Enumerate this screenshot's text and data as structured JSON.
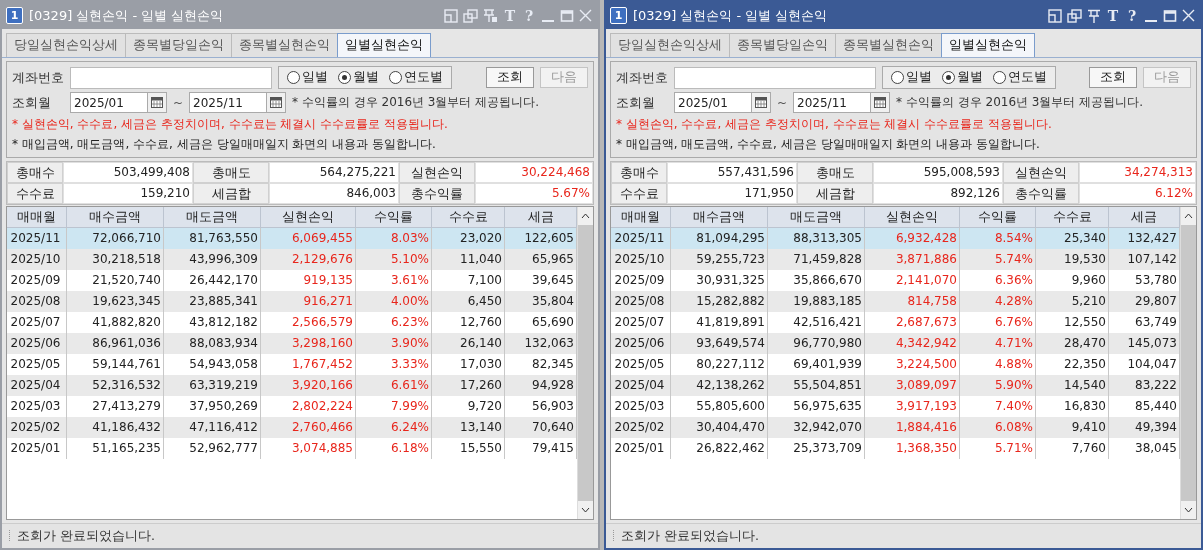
{
  "windows": [
    {
      "active": false,
      "badge": "1",
      "title": "[0329] 실현손익 - 일별 실현손익",
      "tools": [
        {
          "kind": "layout"
        },
        {
          "kind": "copy"
        },
        {
          "kind": "pin-lock"
        },
        {
          "kind": "text",
          "label": "T"
        },
        {
          "kind": "text",
          "label": "?"
        },
        {
          "kind": "minimize"
        },
        {
          "kind": "maximize"
        },
        {
          "kind": "close"
        }
      ],
      "tabs": [
        {
          "label": "당일실현손익상세",
          "selected": false
        },
        {
          "label": "종목별당일손익",
          "selected": false
        },
        {
          "label": "종목별실현손익",
          "selected": false
        },
        {
          "label": "일별실현손익",
          "selected": true
        }
      ],
      "account_label": "계좌번호",
      "radios": [
        {
          "label": "일별",
          "selected": false
        },
        {
          "label": "월별",
          "selected": true
        },
        {
          "label": "연도별",
          "selected": false
        }
      ],
      "buttons": [
        {
          "label": "조회",
          "disabled": false
        },
        {
          "label": "다음",
          "disabled": true
        }
      ],
      "period_label": "조회월",
      "from": "2025/01",
      "tilde": "~",
      "to": "2025/11",
      "period_note": "* 수익률의 경우 2016년 3월부터 제공됩니다.",
      "notes": [
        {
          "text": "* 실현손익, 수수료, 세금은 추정치이며, 수수료는 체결시 수수료률로 적용됩니다.",
          "emphasis": true
        },
        {
          "text": "* 매입금액, 매도금액, 수수료, 세금은 당일매매일지 화면의 내용과 동일합니다.",
          "emphasis": false
        }
      ],
      "summary": [
        {
          "label": "총매수",
          "value": "503,499,408",
          "emphasis": false
        },
        {
          "label": "총매도",
          "value": "564,275,221",
          "emphasis": false
        },
        {
          "label": "실현손익",
          "value": "30,224,468",
          "emphasis": true
        },
        {
          "label": "수수료",
          "value": "159,210",
          "emphasis": false
        },
        {
          "label": "세금합",
          "value": "846,003",
          "emphasis": false
        },
        {
          "label": "총수익률",
          "value": "5.67%",
          "emphasis": true
        }
      ],
      "columns": [
        {
          "label": "매매월",
          "emphasis": false
        },
        {
          "label": "매수금액",
          "emphasis": false
        },
        {
          "label": "매도금액",
          "emphasis": false
        },
        {
          "label": "실현손익",
          "emphasis": true
        },
        {
          "label": "수익률",
          "emphasis": true
        },
        {
          "label": "수수료",
          "emphasis": false
        },
        {
          "label": "세금",
          "emphasis": false
        }
      ],
      "rows": [
        {
          "selected": true,
          "cells": [
            "2025/11",
            "72,066,710",
            "81,763,550",
            "6,069,455",
            "8.03%",
            "23,020",
            "122,605"
          ]
        },
        {
          "selected": false,
          "cells": [
            "2025/10",
            "30,218,518",
            "43,996,309",
            "2,129,676",
            "5.10%",
            "11,040",
            "65,965"
          ]
        },
        {
          "selected": false,
          "cells": [
            "2025/09",
            "21,520,740",
            "26,442,170",
            "919,135",
            "3.61%",
            "7,100",
            "39,645"
          ]
        },
        {
          "selected": false,
          "cells": [
            "2025/08",
            "19,623,345",
            "23,885,341",
            "916,271",
            "4.00%",
            "6,450",
            "35,804"
          ]
        },
        {
          "selected": false,
          "cells": [
            "2025/07",
            "41,882,820",
            "43,812,182",
            "2,566,579",
            "6.23%",
            "12,760",
            "65,690"
          ]
        },
        {
          "selected": false,
          "cells": [
            "2025/06",
            "86,961,036",
            "88,083,934",
            "3,298,160",
            "3.90%",
            "26,140",
            "132,063"
          ]
        },
        {
          "selected": false,
          "cells": [
            "2025/05",
            "59,144,761",
            "54,943,058",
            "1,767,452",
            "3.33%",
            "17,030",
            "82,345"
          ]
        },
        {
          "selected": false,
          "cells": [
            "2025/04",
            "52,316,532",
            "63,319,219",
            "3,920,166",
            "6.61%",
            "17,260",
            "94,928"
          ]
        },
        {
          "selected": false,
          "cells": [
            "2025/03",
            "27,413,279",
            "37,950,269",
            "2,802,224",
            "7.99%",
            "9,720",
            "56,903"
          ]
        },
        {
          "selected": false,
          "cells": [
            "2025/02",
            "41,186,432",
            "47,116,412",
            "2,760,466",
            "6.24%",
            "13,140",
            "70,640"
          ]
        },
        {
          "selected": false,
          "cells": [
            "2025/01",
            "51,165,235",
            "52,962,777",
            "3,074,885",
            "6.18%",
            "15,550",
            "79,415"
          ]
        }
      ],
      "status": "조회가 완료되었습니다."
    },
    {
      "active": true,
      "badge": "1",
      "title": "[0329] 실현손익 - 일별 실현손익",
      "tools": [
        {
          "kind": "layout"
        },
        {
          "kind": "copy"
        },
        {
          "kind": "pin"
        },
        {
          "kind": "text",
          "label": "T"
        },
        {
          "kind": "text",
          "label": "?"
        },
        {
          "kind": "minimize"
        },
        {
          "kind": "maximize"
        },
        {
          "kind": "close"
        }
      ],
      "tabs": [
        {
          "label": "당일실현손익상세",
          "selected": false
        },
        {
          "label": "종목별당일손익",
          "selected": false
        },
        {
          "label": "종목별실현손익",
          "selected": false
        },
        {
          "label": "일별실현손익",
          "selected": true
        }
      ],
      "account_label": "계좌번호",
      "radios": [
        {
          "label": "일별",
          "selected": false
        },
        {
          "label": "월별",
          "selected": true
        },
        {
          "label": "연도별",
          "selected": false
        }
      ],
      "buttons": [
        {
          "label": "조회",
          "disabled": false
        },
        {
          "label": "다음",
          "disabled": true
        }
      ],
      "period_label": "조회월",
      "from": "2025/01",
      "tilde": "~",
      "to": "2025/11",
      "period_note": "* 수익률의 경우 2016년 3월부터 제공됩니다.",
      "notes": [
        {
          "text": "* 실현손익, 수수료, 세금은 추정치이며, 수수료는 체결시 수수료률로 적용됩니다.",
          "emphasis": true
        },
        {
          "text": "* 매입금액, 매도금액, 수수료, 세금은 당일매매일지 화면의 내용과 동일합니다.",
          "emphasis": false
        }
      ],
      "summary": [
        {
          "label": "총매수",
          "value": "557,431,596",
          "emphasis": false
        },
        {
          "label": "총매도",
          "value": "595,008,593",
          "emphasis": false
        },
        {
          "label": "실현손익",
          "value": "34,274,313",
          "emphasis": true
        },
        {
          "label": "수수료",
          "value": "171,950",
          "emphasis": false
        },
        {
          "label": "세금합",
          "value": "892,126",
          "emphasis": false
        },
        {
          "label": "총수익률",
          "value": "6.12%",
          "emphasis": true
        }
      ],
      "columns": [
        {
          "label": "매매월",
          "emphasis": false
        },
        {
          "label": "매수금액",
          "emphasis": false
        },
        {
          "label": "매도금액",
          "emphasis": false
        },
        {
          "label": "실현손익",
          "emphasis": true
        },
        {
          "label": "수익률",
          "emphasis": true
        },
        {
          "label": "수수료",
          "emphasis": false
        },
        {
          "label": "세금",
          "emphasis": false
        }
      ],
      "rows": [
        {
          "selected": true,
          "cells": [
            "2025/11",
            "81,094,295",
            "88,313,305",
            "6,932,428",
            "8.54%",
            "25,340",
            "132,427"
          ]
        },
        {
          "selected": false,
          "cells": [
            "2025/10",
            "59,255,723",
            "71,459,828",
            "3,871,886",
            "5.74%",
            "19,530",
            "107,142"
          ]
        },
        {
          "selected": false,
          "cells": [
            "2025/09",
            "30,931,325",
            "35,866,670",
            "2,141,070",
            "6.36%",
            "9,960",
            "53,780"
          ]
        },
        {
          "selected": false,
          "cells": [
            "2025/08",
            "15,282,882",
            "19,883,185",
            "814,758",
            "4.28%",
            "5,210",
            "29,807"
          ]
        },
        {
          "selected": false,
          "cells": [
            "2025/07",
            "41,819,891",
            "42,516,421",
            "2,687,673",
            "6.76%",
            "12,550",
            "63,749"
          ]
        },
        {
          "selected": false,
          "cells": [
            "2025/06",
            "93,649,574",
            "96,770,980",
            "4,342,942",
            "4.71%",
            "28,470",
            "145,073"
          ]
        },
        {
          "selected": false,
          "cells": [
            "2025/05",
            "80,227,112",
            "69,401,939",
            "3,224,500",
            "4.88%",
            "22,350",
            "104,047"
          ]
        },
        {
          "selected": false,
          "cells": [
            "2025/04",
            "42,138,262",
            "55,504,851",
            "3,089,097",
            "5.90%",
            "14,540",
            "83,222"
          ]
        },
        {
          "selected": false,
          "cells": [
            "2025/03",
            "55,805,600",
            "56,975,635",
            "3,917,193",
            "7.40%",
            "16,830",
            "85,440"
          ]
        },
        {
          "selected": false,
          "cells": [
            "2025/02",
            "30,404,470",
            "32,942,070",
            "1,884,416",
            "6.08%",
            "9,410",
            "49,394"
          ]
        },
        {
          "selected": false,
          "cells": [
            "2025/01",
            "26,822,462",
            "25,373,709",
            "1,368,350",
            "5.71%",
            "7,760",
            "38,045"
          ]
        }
      ],
      "status": "조회가 완료되었습니다."
    }
  ]
}
